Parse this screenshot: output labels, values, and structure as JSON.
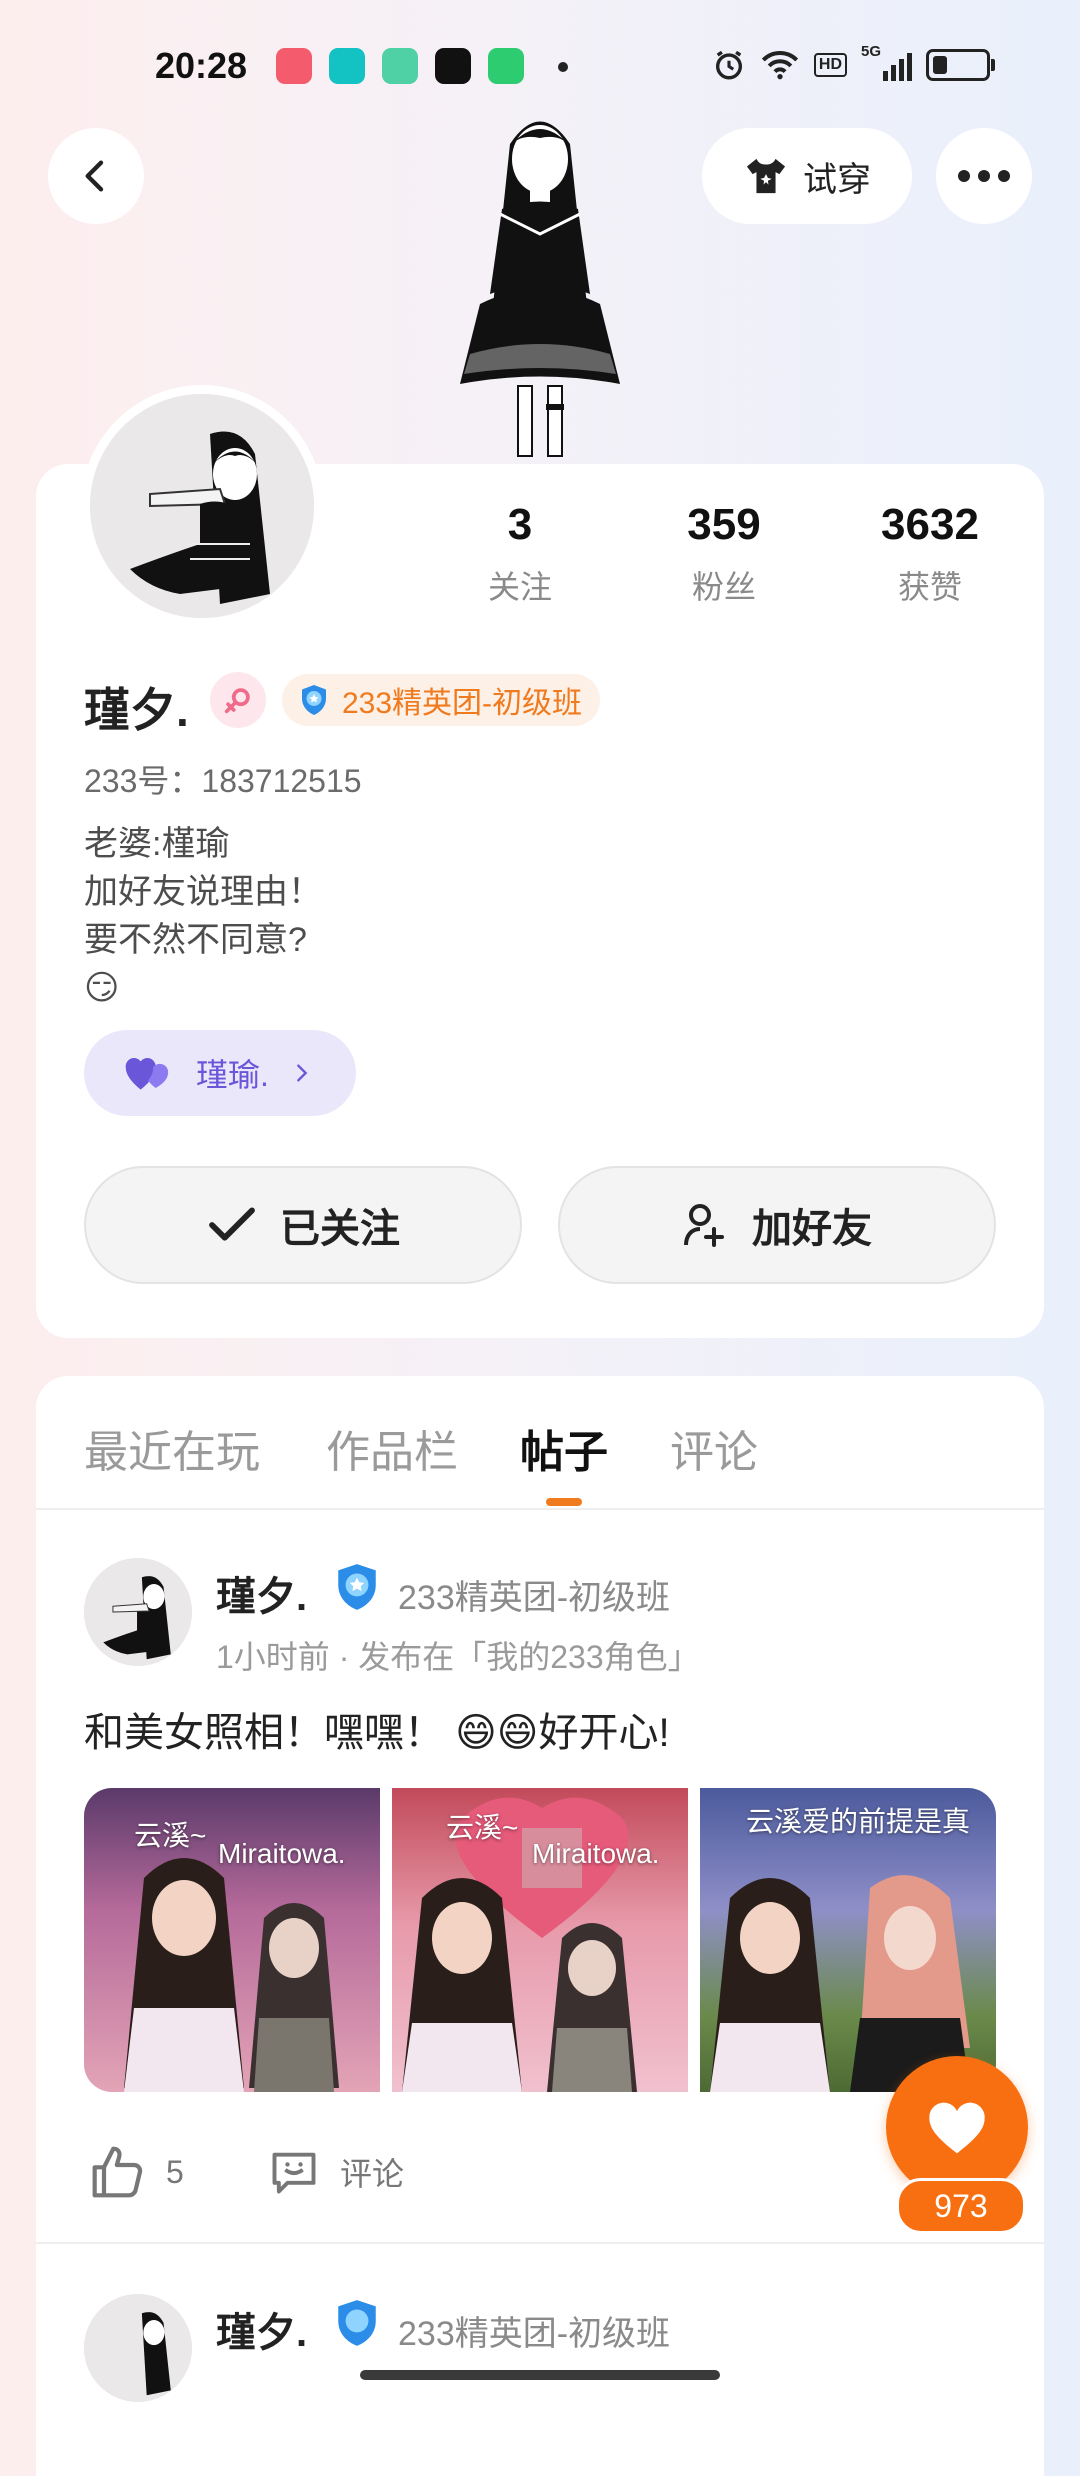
{
  "status_bar": {
    "time": "20:28",
    "network": "5G",
    "hd": "HD",
    "app_icons": [
      "app-icon-pink",
      "app-icon-teal-house",
      "app-icon-green",
      "tiktok-icon",
      "iqiyi-icon"
    ],
    "app_colors": [
      "#f45b6d",
      "#13c2c2",
      "#4fd1a5",
      "#111111",
      "#2ecc71"
    ]
  },
  "header": {
    "back_icon": "chevron-left-icon",
    "try_on_label": "试穿",
    "more_icon": "more-dots-icon"
  },
  "profile": {
    "stats": [
      {
        "value": "3",
        "label": "关注"
      },
      {
        "value": "359",
        "label": "粉丝"
      },
      {
        "value": "3632",
        "label": "获赞"
      }
    ],
    "name": "瑾夕.",
    "gender_icon": "female-icon",
    "badge": "233精英团-初级班",
    "uid": "233号：183712515",
    "bio": [
      "老婆:槿瑜",
      "加好友说理由！",
      "要不然不同意?",
      "😏"
    ],
    "cp_name": "瑾瑜.",
    "follow_label": "已关注",
    "add_friend_label": "加好友"
  },
  "tabs": [
    {
      "label": "最近在玩",
      "active": false
    },
    {
      "label": "作品栏",
      "active": false
    },
    {
      "label": "帖子",
      "active": true
    },
    {
      "label": "评论",
      "active": false
    }
  ],
  "post": {
    "author": "瑾夕.",
    "badge": "233精英团-初级班",
    "meta": "1小时前 · 发布在「我的233角色」",
    "text": "和美女照相！嘿嘿！ 😄😄好开心!",
    "photos": [
      {
        "labels": [
          "云溪~",
          "Miraitowa."
        ]
      },
      {
        "labels": [
          "云溪~",
          "Miraitowa."
        ]
      },
      {
        "labels": [
          "云溪爱的前提是真"
        ]
      }
    ],
    "likes": "5",
    "comment_label": "评论"
  },
  "next_post": {
    "author": "瑾夕.",
    "badge": "233精英团-初级班"
  },
  "fab": {
    "count": "973",
    "color": "#f86f11"
  }
}
